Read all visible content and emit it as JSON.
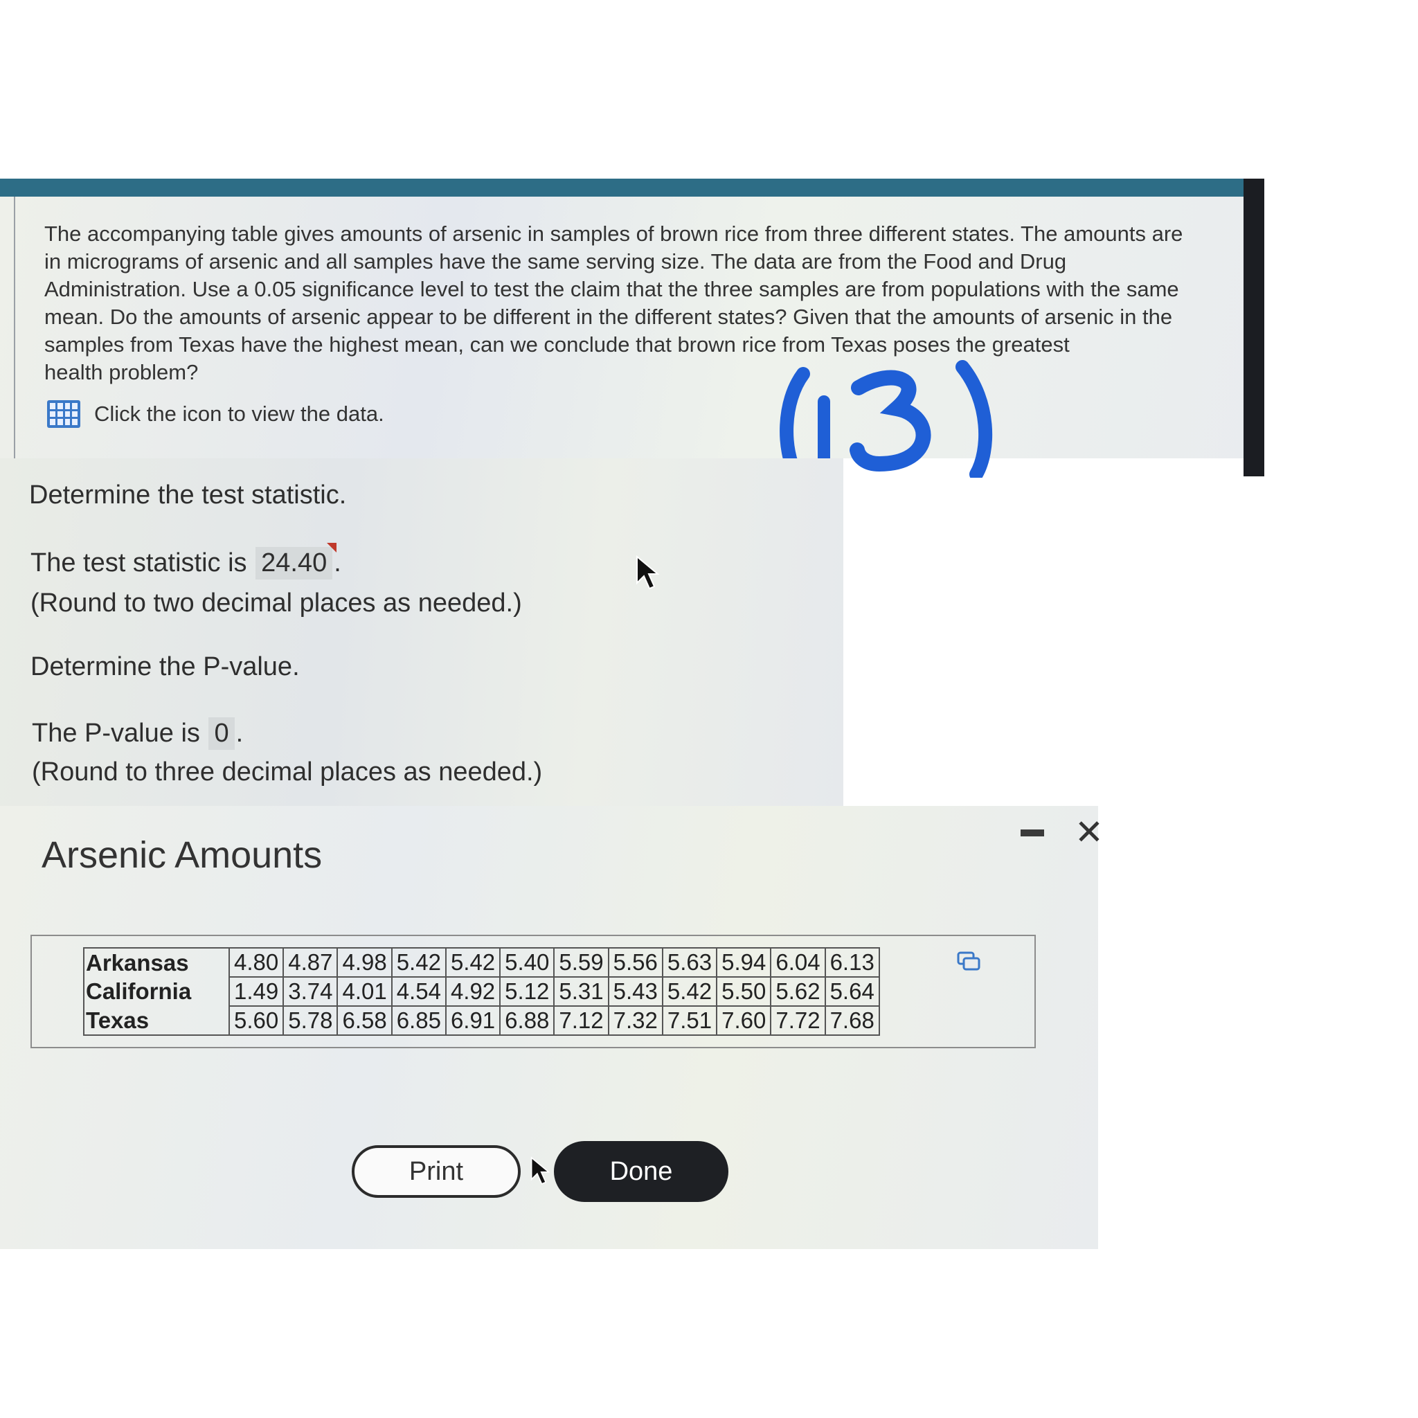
{
  "question": {
    "lines": [
      "The accompanying table gives amounts of arsenic in samples of brown rice from three different states. The amounts are",
      "in micrograms of arsenic and all samples have the same serving size. The data are from the Food and Drug",
      "Administration. Use a 0.05 significance level to test the claim that the three samples are from populations with the same",
      "mean. Do the amounts of arsenic appear to be different in the different states? Given that the amounts of arsenic in the",
      "samples from Texas have the highest mean, can we conclude that brown rice from Texas poses the greatest",
      "health problem?"
    ],
    "data_link_label": "Click the icon to view the data."
  },
  "answers": {
    "test_stat_heading": "Determine the test statistic.",
    "test_stat_prefix": "The test statistic is",
    "test_stat_value": "24.40",
    "test_stat_suffix": ".",
    "test_stat_note": "(Round to two decimal places as needed.)",
    "pvalue_heading": "Determine the P-value.",
    "pvalue_prefix": "The P-value is",
    "pvalue_value": "0",
    "pvalue_suffix": ".",
    "pvalue_note": "(Round to three decimal places as needed.)"
  },
  "popup": {
    "title": "Arsenic Amounts",
    "close_glyph": "✕",
    "rows": [
      {
        "state": "Arkansas",
        "values": [
          "4.80",
          "4.87",
          "4.98",
          "5.42",
          "5.42",
          "5.40",
          "5.59",
          "5.56",
          "5.63",
          "5.94",
          "6.04",
          "6.13"
        ]
      },
      {
        "state": "California",
        "values": [
          "1.49",
          "3.74",
          "4.01",
          "4.54",
          "4.92",
          "5.12",
          "5.31",
          "5.43",
          "5.42",
          "5.50",
          "5.62",
          "5.64"
        ]
      },
      {
        "state": "Texas",
        "values": [
          "5.60",
          "5.78",
          "6.58",
          "6.85",
          "6.91",
          "6.88",
          "7.12",
          "7.32",
          "7.51",
          "7.60",
          "7.72",
          "7.68"
        ]
      }
    ],
    "print_label": "Print",
    "done_label": "Done"
  },
  "colors": {
    "header_bar": "#2d6d86",
    "done_button": "#1e2024",
    "data_icon": "#3a78c8",
    "annotation_ink": "#1f5fd6"
  },
  "icons": [
    "grid-data-icon",
    "copy-icon",
    "minimize-icon",
    "close-icon",
    "mouse-cursor-icon"
  ]
}
